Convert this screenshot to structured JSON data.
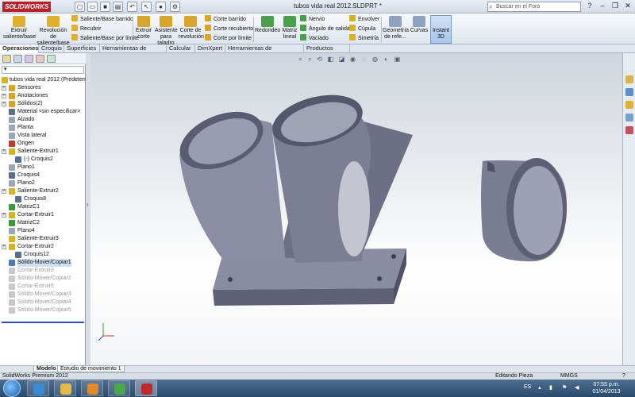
{
  "app": {
    "logo_text": "SOLIDWORKS",
    "doc_title": "tubos vida real 2012.SLDPRT *"
  },
  "search": {
    "placeholder": "Buscar en el Foro"
  },
  "ribbon": {
    "extrude_boss": "Extruir saliente/base",
    "revolve_boss": "Revolución de saliente/base",
    "swept_boss": "Saliente/Base barrido",
    "loft": "Recubrir",
    "boundary_boss": "Saliente/Base por límite",
    "extrude_cut": "Extruir corte",
    "hole_wizard": "Asistente para taladro",
    "revolve_cut": "Corte de revolución",
    "swept_cut": "Corte barrido",
    "lofted_cut": "Corte recubierto",
    "boundary_cut": "Corte por límite",
    "fillet": "Redondeo",
    "linear_pattern": "Matriz lineal",
    "rib": "Nervio",
    "draft": "Ángulo de salida",
    "shell": "Vaciado",
    "wrap": "Envolver",
    "dome": "Cúpula",
    "mirror": "Simetría",
    "ref_geometry": "Geometría de refe...",
    "curves": "Curvas",
    "instant3d": "Instant 3D"
  },
  "tabs": [
    "Operaciones",
    "Croquis",
    "Superficies",
    "Herramientas de moldes",
    "Calcular",
    "DimXpert",
    "Herramientas de renderizado",
    "Productos Office"
  ],
  "tree": {
    "root": "tubos vida real 2012  (Predeterm",
    "items": [
      {
        "label": "Sensores",
        "color": "#d9a520"
      },
      {
        "label": "Anotaciones",
        "color": "#d9a520"
      },
      {
        "label": "Sólidos(2)",
        "color": "#d9a520"
      },
      {
        "label": "Material <sin especificar>",
        "color": "#5a6f8a"
      },
      {
        "label": "Alzado",
        "color": "#9aa7b7"
      },
      {
        "label": "Planta",
        "color": "#9aa7b7"
      },
      {
        "label": "Vista lateral",
        "color": "#9aa7b7"
      },
      {
        "label": "Origen",
        "color": "#c0392b"
      },
      {
        "label": "Saliente-Extruir1",
        "color": "#d6b420"
      },
      {
        "label": "(-) Croquis2",
        "color": "#5a6f8a"
      },
      {
        "label": "Plano1",
        "color": "#9aa7b7"
      },
      {
        "label": "Croquis4",
        "color": "#5a6f8a"
      },
      {
        "label": "Plano2",
        "color": "#9aa7b7"
      },
      {
        "label": "Saliente-Extruir2",
        "color": "#d6b420"
      },
      {
        "label": "Croquis8",
        "color": "#5a6f8a"
      },
      {
        "label": "MatrizC1",
        "color": "#3a9a3a"
      },
      {
        "label": "Cortar-Extruir1",
        "color": "#d6b420"
      },
      {
        "label": "MatrizC2",
        "color": "#3a9a3a"
      },
      {
        "label": "Plano4",
        "color": "#9aa7b7"
      },
      {
        "label": "Saliente-Extruir3",
        "color": "#d6b420"
      },
      {
        "label": "Cortar-Extruir2",
        "color": "#d6b420"
      },
      {
        "label": "Croquis12",
        "color": "#5a6f8a"
      },
      {
        "label": "Sólido-Mover/Copiar1",
        "color": "#4a7ab8"
      },
      {
        "label": "Cortar-Extruir3",
        "color": "#c8c8c8"
      },
      {
        "label": "Sólido-Mover/Copiar2",
        "color": "#c8c8c8"
      },
      {
        "label": "Cortar-Extruir5",
        "color": "#c8c8c8"
      },
      {
        "label": "Sólido-Mover/Copiar3",
        "color": "#c8c8c8"
      },
      {
        "label": "Sólido-Mover/Copiar4",
        "color": "#c8c8c8"
      },
      {
        "label": "Sólido-Mover/Copiar5",
        "color": "#c8c8c8"
      }
    ]
  },
  "bottom_tabs": [
    "Modelo",
    "Estudio de movimiento 1"
  ],
  "status": {
    "product": "SolidWorks Premium 2012",
    "mode": "Editando Pieza",
    "units": "MMGS"
  },
  "taskbar": {
    "lang": "ES",
    "time": "07:55 p.m.",
    "date": "01/04/2013"
  },
  "colors": {
    "model_fill": "#7c7f94",
    "model_dark": "#4f5266",
    "accent": "#2a52be"
  }
}
